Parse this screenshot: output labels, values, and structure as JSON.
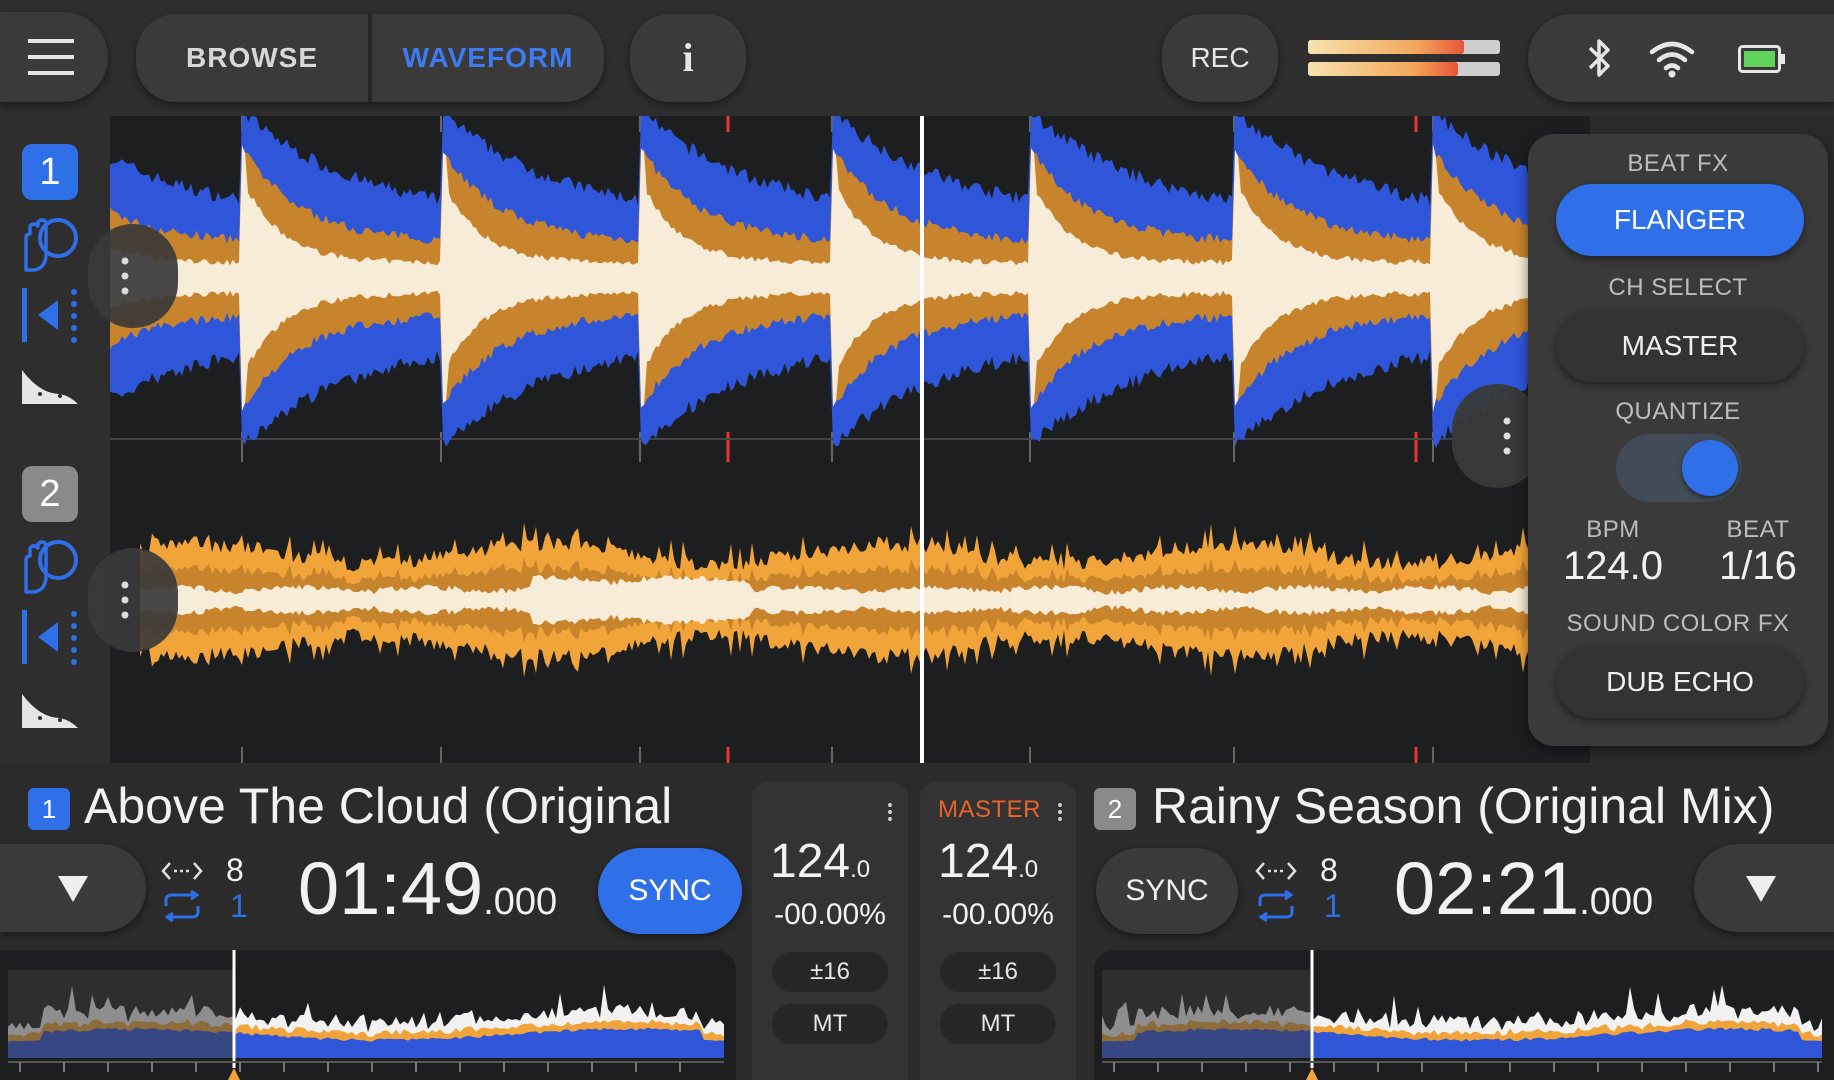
{
  "topbar": {
    "tabs": [
      {
        "label": "BROWSE",
        "active": false
      },
      {
        "label": "WAVEFORM",
        "active": true
      }
    ],
    "info_label": "i",
    "rec_label": "REC"
  },
  "colors": {
    "accent": "#2f6fe8",
    "master_orange": "#e8642a",
    "wave_orange": "#f0a43a",
    "wave_blue": "#2f56d9",
    "wave_cream": "#f6ecd8"
  },
  "decks": [
    {
      "number": "1",
      "title": "Above The Cloud (Original",
      "beat_jump": "8",
      "loop": "1",
      "time_main": "01:49",
      "time_ms": ".000",
      "sync_label": "SYNC",
      "sync_active": true,
      "bpm": "124",
      "bpm_decimal": ".0",
      "pitch": "-00.00%",
      "range_label": "±16",
      "mt_label": "MT"
    },
    {
      "number": "2",
      "title": "Rainy Season (Original Mix)",
      "beat_jump": "8",
      "loop": "1",
      "time_main": "02:21",
      "time_ms": ".000",
      "sync_label": "SYNC",
      "sync_active": false,
      "bpm": "124",
      "bpm_decimal": ".0",
      "pitch": "-00.00%",
      "range_label": "±16",
      "mt_label": "MT",
      "master_label": "MASTER"
    }
  ],
  "fx_panel": {
    "beat_fx_label": "BEAT FX",
    "beat_fx_value": "FLANGER",
    "ch_select_label": "CH SELECT",
    "ch_select_value": "MASTER",
    "quantize_label": "QUANTIZE",
    "quantize_on": true,
    "bpm_label": "BPM",
    "bpm_value": "124.0",
    "beat_label": "BEAT",
    "beat_value": "1/16",
    "sound_color_label": "SOUND COLOR FX",
    "sound_color_value": "DUB ECHO"
  }
}
